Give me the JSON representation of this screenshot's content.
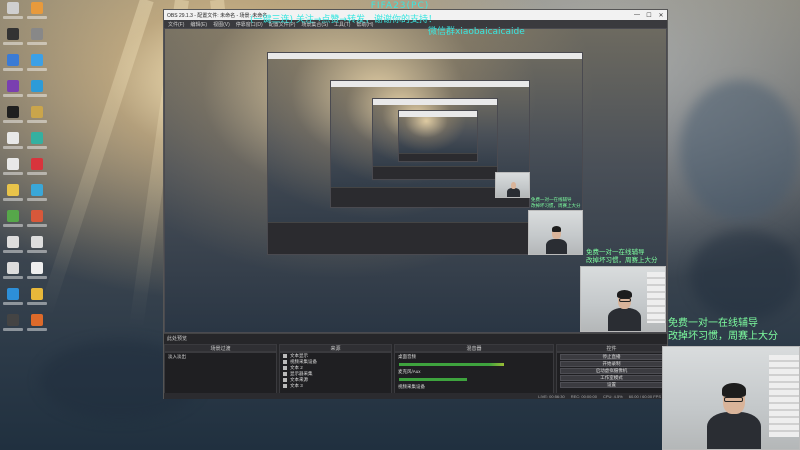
{
  "overlay": {
    "title": "FIFA23(PC)",
    "line2": "(一键三连) 关注→点赞→转发，谢谢你的支持！",
    "wechat": "微信群xiaobaicaicaide"
  },
  "promo": {
    "line1": "免费一对一在线辅导",
    "line2": "改掉坏习惯，周赛上大分"
  },
  "obs": {
    "title": "OBS 29.1.3 - 配置文件: 未命名 - 场景: 未命名",
    "menu": [
      "文件(F)",
      "编辑(E)",
      "视图(V)",
      "停靠窗口(D)",
      "配置文件(P)",
      "场景集合(S)",
      "工具(T)",
      "帮助(H)"
    ],
    "dock_label": "此处预览",
    "panels": {
      "scenes": "场景过渡",
      "sources": "来源",
      "mixer": "混音器",
      "controls": "控件"
    },
    "sources": [
      "文本显示",
      "视频采集设备",
      "文本 2",
      "显示器采集",
      "文本来源",
      "文本 3"
    ],
    "mixer": [
      "桌面音频",
      "麦克风/Aux",
      "视频采集设备"
    ],
    "controls": [
      "停止直播",
      "开始录制",
      "启动虚拟摄像机",
      "工作室模式",
      "设置",
      "退出"
    ],
    "transition": "淡入淡出",
    "status": [
      "LIVE: 00:56:30",
      "REC: 00:00:00",
      "CPU: 4.5%",
      "60.00 / 60.00 FPS"
    ]
  },
  "colors": {
    "overlay_cyan": "#39e6e0",
    "promo_green": "#7effa0",
    "obs_dark": "#2b2b2f"
  }
}
